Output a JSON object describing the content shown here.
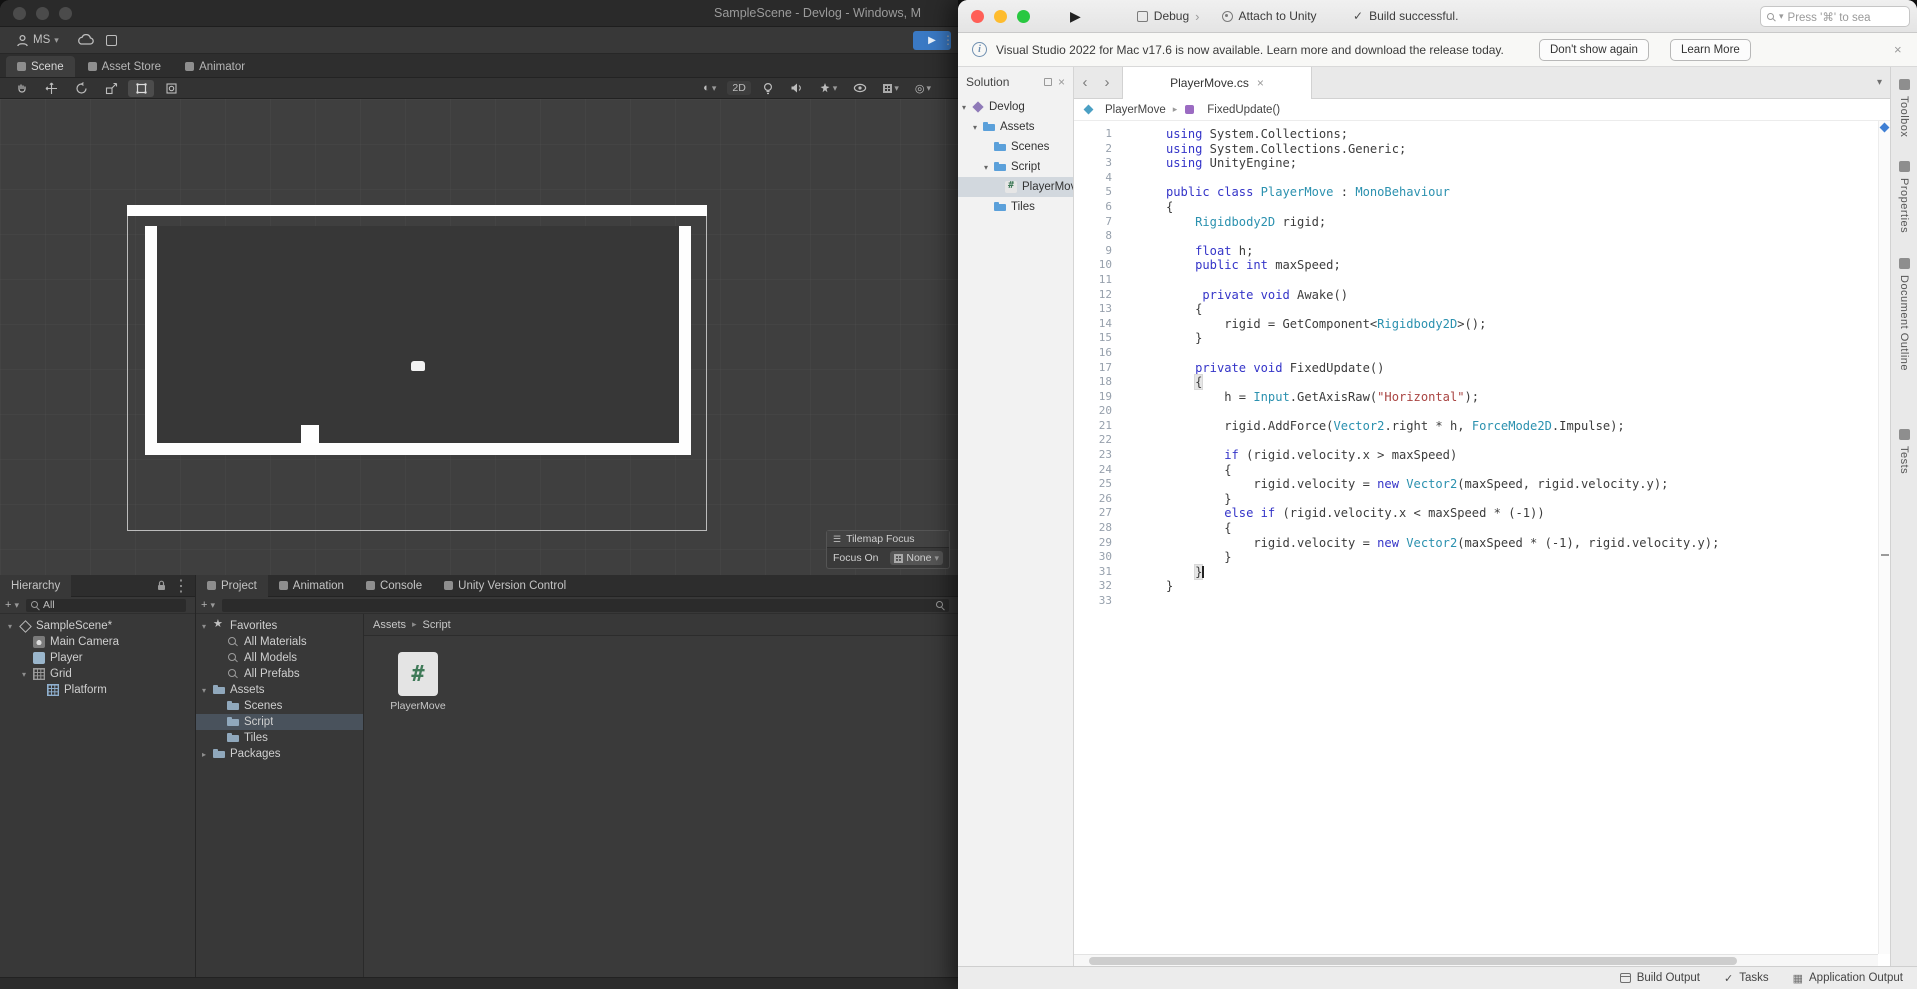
{
  "colors": {
    "keyword": "#3434c8",
    "type": "#2b91af",
    "string": "#a94442",
    "plain": "#3c3c3c",
    "traffic_red": "#ff5f57",
    "traffic_yellow": "#febc2e",
    "traffic_green": "#28c840",
    "unity_play_blue": "#3a79c4"
  },
  "unity": {
    "title": "SampleScene - Devlog - Windows, M",
    "account_label": "MS",
    "tabs": [
      {
        "label": "Scene",
        "active": true
      },
      {
        "label": "Asset Store",
        "active": false
      },
      {
        "label": "Animator",
        "active": false
      }
    ],
    "scene_toolbar": {
      "mode2d_label": "2D"
    },
    "tilemap_overlay": {
      "title": "Tilemap Focus",
      "focus_label": "Focus On",
      "focus_value": "None"
    },
    "hierarchy": {
      "tab_label": "Hierarchy",
      "search_value": "All",
      "items": [
        {
          "label": "SampleScene*",
          "depth": 0,
          "arrow": "▾",
          "icon": "unity-scene"
        },
        {
          "label": "Main Camera",
          "depth": 1,
          "icon": "camera"
        },
        {
          "label": "Player",
          "depth": 1,
          "icon": "player"
        },
        {
          "label": "Grid",
          "depth": 1,
          "arrow": "▾",
          "icon": "grid"
        },
        {
          "label": "Platform",
          "depth": 2,
          "icon": "tilemap"
        }
      ]
    },
    "project": {
      "tabs": [
        {
          "label": "Project",
          "active": true
        },
        {
          "label": "Animation",
          "active": false
        },
        {
          "label": "Console",
          "active": false
        },
        {
          "label": "Unity Version Control",
          "active": false
        }
      ],
      "tree": [
        {
          "label": "Favorites",
          "depth": 0,
          "arrow": "▾",
          "icon": "star"
        },
        {
          "label": "All Materials",
          "depth": 1,
          "icon": "search"
        },
        {
          "label": "All Models",
          "depth": 1,
          "icon": "search"
        },
        {
          "label": "All Prefabs",
          "depth": 1,
          "icon": "search"
        },
        {
          "label": "Assets",
          "depth": 0,
          "arrow": "▾",
          "icon": "folder"
        },
        {
          "label": "Scenes",
          "depth": 1,
          "icon": "folder"
        },
        {
          "label": "Script",
          "depth": 1,
          "icon": "folder",
          "selected": true
        },
        {
          "label": "Tiles",
          "depth": 1,
          "icon": "folder"
        },
        {
          "label": "Packages",
          "depth": 0,
          "arrow": "▸",
          "icon": "folder"
        }
      ],
      "breadcrumb": [
        "Assets",
        "Script"
      ],
      "items": [
        {
          "label": "PlayerMove",
          "icon": "csharp"
        }
      ]
    }
  },
  "vs": {
    "topbar": {
      "debug_label": "Debug",
      "attach_label": "Attach to Unity",
      "status_message": "Build successful.",
      "search_placeholder": "Press '⌘' to sea"
    },
    "notification": {
      "message": "Visual Studio 2022 for Mac v17.6 is now available. Learn more and download the release today.",
      "dismiss_label": "Don't show again",
      "learn_more_label": "Learn More"
    },
    "solution": {
      "header": "Solution",
      "tree": [
        {
          "label": "Devlog",
          "depth": 0,
          "arrow": "▾",
          "icon": "solution"
        },
        {
          "label": "Assets",
          "depth": 1,
          "arrow": "▾",
          "icon": "folder"
        },
        {
          "label": "Scenes",
          "depth": 2,
          "icon": "folder"
        },
        {
          "label": "Script",
          "depth": 2,
          "arrow": "▾",
          "icon": "folder"
        },
        {
          "label": "PlayerMove",
          "depth": 3,
          "icon": "csharp",
          "selected": true
        },
        {
          "label": "Tiles",
          "depth": 2,
          "icon": "folder"
        }
      ]
    },
    "editor": {
      "tab_label": "PlayerMove.cs",
      "breadcrumb": [
        {
          "label": "PlayerMove",
          "icon": "class"
        },
        {
          "label": "FixedUpdate()",
          "icon": "method"
        }
      ]
    },
    "code": {
      "lines": [
        [
          [
            "k",
            "using"
          ],
          [
            "p",
            " System.Collections;"
          ]
        ],
        [
          [
            "k",
            "using"
          ],
          [
            "p",
            " System.Collections.Generic;"
          ]
        ],
        [
          [
            "k",
            "using"
          ],
          [
            "p",
            " UnityEngine;"
          ]
        ],
        [],
        [
          [
            "k",
            "public"
          ],
          [
            "p",
            " "
          ],
          [
            "k",
            "class"
          ],
          [
            "p",
            " "
          ],
          [
            "t",
            "PlayerMove"
          ],
          [
            "p",
            " : "
          ],
          [
            "t",
            "MonoBehaviour"
          ]
        ],
        [
          [
            "p",
            "{"
          ]
        ],
        [
          [
            "p",
            "    "
          ],
          [
            "t",
            "Rigidbody2D"
          ],
          [
            "p",
            " rigid;"
          ]
        ],
        [],
        [
          [
            "p",
            "    "
          ],
          [
            "k",
            "float"
          ],
          [
            "p",
            " h;"
          ]
        ],
        [
          [
            "p",
            "    "
          ],
          [
            "k",
            "public"
          ],
          [
            "p",
            " "
          ],
          [
            "k",
            "int"
          ],
          [
            "p",
            " maxSpeed;"
          ]
        ],
        [],
        [
          [
            "p",
            "     "
          ],
          [
            "k",
            "private"
          ],
          [
            "p",
            " "
          ],
          [
            "k",
            "void"
          ],
          [
            "p",
            " Awake()"
          ]
        ],
        [
          [
            "p",
            "    {"
          ]
        ],
        [
          [
            "p",
            "        rigid = GetComponent<"
          ],
          [
            "t",
            "Rigidbody2D"
          ],
          [
            "p",
            ">();"
          ]
        ],
        [
          [
            "p",
            "    }"
          ]
        ],
        [],
        [
          [
            "p",
            "    "
          ],
          [
            "k",
            "private"
          ],
          [
            "p",
            " "
          ],
          [
            "k",
            "void"
          ],
          [
            "p",
            " FixedUpdate()"
          ]
        ],
        [
          [
            "p",
            "    "
          ],
          [
            "b",
            "{"
          ]
        ],
        [
          [
            "p",
            "        h = "
          ],
          [
            "t",
            "Input"
          ],
          [
            "p",
            ".GetAxisRaw("
          ],
          [
            "s",
            "\"Horizontal\""
          ],
          [
            "p",
            ");"
          ]
        ],
        [],
        [
          [
            "p",
            "        rigid.AddForce("
          ],
          [
            "t",
            "Vector2"
          ],
          [
            "p",
            ".right * h, "
          ],
          [
            "t",
            "ForceMode2D"
          ],
          [
            "p",
            ".Impulse);"
          ]
        ],
        [],
        [
          [
            "p",
            "        "
          ],
          [
            "k",
            "if"
          ],
          [
            "p",
            " (rigid.velocity.x > maxSpeed)"
          ]
        ],
        [
          [
            "p",
            "        {"
          ]
        ],
        [
          [
            "p",
            "            rigid.velocity = "
          ],
          [
            "k",
            "new"
          ],
          [
            "p",
            " "
          ],
          [
            "t",
            "Vector2"
          ],
          [
            "p",
            "(maxSpeed, rigid.velocity.y);"
          ]
        ],
        [
          [
            "p",
            "        }"
          ]
        ],
        [
          [
            "p",
            "        "
          ],
          [
            "k",
            "else"
          ],
          [
            "p",
            " "
          ],
          [
            "k",
            "if"
          ],
          [
            "p",
            " (rigid.velocity.x < maxSpeed * (-1))"
          ]
        ],
        [
          [
            "p",
            "        {"
          ]
        ],
        [
          [
            "p",
            "            rigid.velocity = "
          ],
          [
            "k",
            "new"
          ],
          [
            "p",
            " "
          ],
          [
            "t",
            "Vector2"
          ],
          [
            "p",
            "(maxSpeed * (-1), rigid.velocity.y);"
          ]
        ],
        [
          [
            "p",
            "        }"
          ]
        ],
        [
          [
            "p",
            "    "
          ],
          [
            "b",
            "}"
          ],
          [
            "c",
            ""
          ]
        ],
        [
          [
            "p",
            "}"
          ]
        ],
        []
      ]
    },
    "side_tabs": [
      "Toolbox",
      "Properties",
      "Document Outline",
      "Tests"
    ],
    "statusbar": [
      "Build Output",
      "Tasks",
      "Application Output"
    ]
  }
}
